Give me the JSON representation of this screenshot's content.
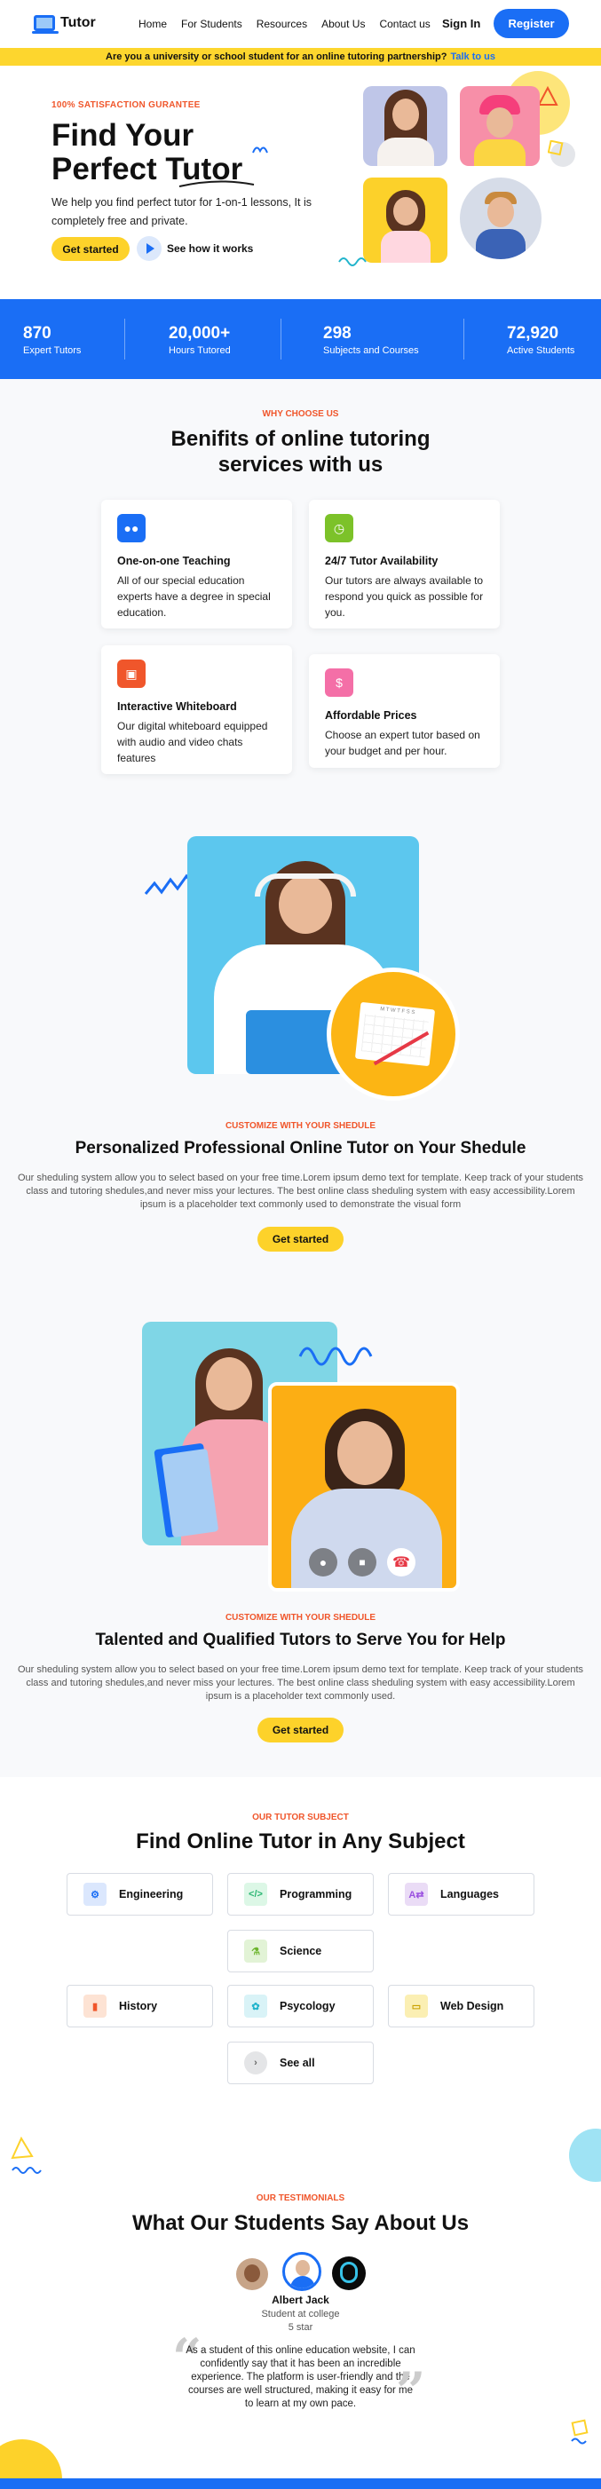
{
  "nav": {
    "logo": "Tutor",
    "links": [
      "Home",
      "For Students",
      "Resources",
      "About Us",
      "Contact us"
    ],
    "signin": "Sign In",
    "register": "Register"
  },
  "banner": {
    "text": "Are you a university or school student for an online tutoring partnership?",
    "link": "Talk to us"
  },
  "hero": {
    "kicker": "100% SATISFACTION GURANTEE",
    "title_line1": "Find Your",
    "title_line2": "Perfect Tutor",
    "sub": "We help you find perfect tutor for 1-on-1 lessons, It is completely free and private.",
    "start": "Get started",
    "how": "See how it works"
  },
  "stats": [
    {
      "num": "870",
      "label": "Expert Tutors"
    },
    {
      "num": "20,000+",
      "label": "Hours Tutored"
    },
    {
      "num": "298",
      "label": "Subjects and Courses"
    },
    {
      "num": "72,920",
      "label": "Active Students"
    }
  ],
  "benefits": {
    "kicker": "WHY CHOOSE US",
    "title_line1": "Benifits of online tutoring",
    "title_line2": "services with us",
    "cards": [
      {
        "title": "One-on-one Teaching",
        "desc": "All of our special education experts have a degree in special education.",
        "color": "#1a6ef5",
        "icon": "users-icon"
      },
      {
        "title": "24/7 Tutor Availability",
        "desc": "Our tutors are always available to respond you quick as possible for you.",
        "color": "#7cc229",
        "icon": "clock-icon"
      },
      {
        "title": "Interactive Whiteboard",
        "desc": "Our digital whiteboard equipped with audio and video chats features",
        "color": "#f0562b",
        "icon": "whiteboard-icon"
      },
      {
        "title": "Affordable Prices",
        "desc": "Choose an expert tutor based on your budget and per hour.",
        "color": "#f46fa7",
        "icon": "money-icon"
      }
    ]
  },
  "feature1": {
    "kicker": "CUSTOMIZE WITH YOUR SHEDULE",
    "title": "Personalized Professional Online Tutor on Your Shedule",
    "desc": "Our sheduling system allow you to select based on your free time.Lorem ipsum demo text for template. Keep track of your students class and tutoring shedules,and never miss your lectures. The best online class sheduling system with easy accessibility.Lorem ipsum is a placeholder text commonly used to demonstrate the visual form",
    "button": "Get started",
    "calendar_days": "M T W T F S S"
  },
  "feature2": {
    "kicker": "CUSTOMIZE WITH YOUR SHEDULE",
    "title": "Talented and Qualified Tutors to Serve You for Help",
    "desc": "Our sheduling system allow you to select based on your free time.Lorem ipsum demo text for template. Keep track of your students class and tutoring shedules,and never miss your lectures. The best online class sheduling system with easy accessibility.Lorem ipsum is a placeholder text commonly used.",
    "button": "Get started"
  },
  "subjects": {
    "kicker": "OUR TUTOR SUBJECT",
    "title": "Find Online Tutor in Any Subject",
    "items": [
      {
        "label": "Engineering",
        "icon": "gear-icon",
        "bg": "#dbe7fd",
        "fg": "#1a6ef5"
      },
      {
        "label": "Programming",
        "icon": "code-icon",
        "bg": "#dcf7e6",
        "fg": "#2bb673"
      },
      {
        "label": "Languages",
        "icon": "translate-icon",
        "bg": "#eadcf6",
        "fg": "#9b51e0"
      },
      {
        "label": "Science",
        "icon": "science-icon",
        "bg": "#e2f3d6",
        "fg": "#6bb42b"
      },
      {
        "label": "History",
        "icon": "book-icon",
        "bg": "#fde3d4",
        "fg": "#f0562b"
      },
      {
        "label": "Psycology",
        "icon": "brain-icon",
        "bg": "#d9f3f7",
        "fg": "#22b4cc"
      },
      {
        "label": "Web Design",
        "icon": "monitor-icon",
        "bg": "#fbefb3",
        "fg": "#c9a100"
      },
      {
        "label": "See all",
        "icon": "arrow-right-icon",
        "bg": "#e4e5e7",
        "fg": "#666"
      }
    ]
  },
  "testimonials": {
    "kicker": "OUR TESTIMONIALS",
    "title": "What Our Students Say About Us",
    "name": "Albert Jack",
    "role": "Student at college",
    "rating": "5 star",
    "quote": "As a student of this online education website, I can confidently say that it has been an incredible experience. The platform is user-friendly and the courses are well structured, making it easy for me to learn at my own pace."
  },
  "colors": {
    "primary": "#1a6ef5",
    "accent": "#fdd22a",
    "kicker": "#f0562b"
  }
}
